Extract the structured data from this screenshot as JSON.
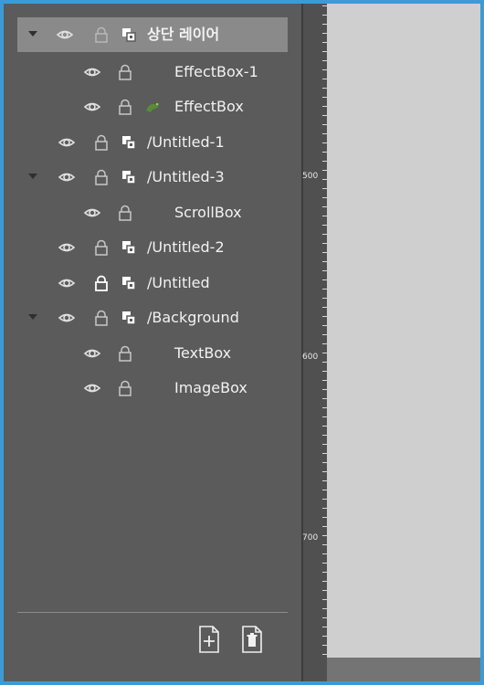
{
  "layers": [
    {
      "name": "상단 레이어",
      "selected": true,
      "expanded": true,
      "type": "group",
      "icon": "layer-group-icon"
    },
    {
      "name": "EffectBox-1",
      "type": "child",
      "icon": null
    },
    {
      "name": "EffectBox",
      "type": "child",
      "icon": "dragon-icon"
    },
    {
      "name": "/Untitled-1",
      "type": "group",
      "icon": "layer-group-icon"
    },
    {
      "name": "/Untitled-3",
      "expanded": true,
      "type": "group",
      "icon": "layer-group-icon"
    },
    {
      "name": "ScrollBox",
      "type": "child",
      "icon": null
    },
    {
      "name": "/Untitled-2",
      "type": "group",
      "icon": "layer-group-icon"
    },
    {
      "name": "/Untitled",
      "type": "group",
      "icon": "layer-group-icon",
      "locked_emphasis": true
    },
    {
      "name": "/Background",
      "expanded": true,
      "type": "group",
      "icon": "layer-group-icon"
    },
    {
      "name": "TextBox",
      "type": "child",
      "icon": null
    },
    {
      "name": "ImageBox",
      "type": "child",
      "icon": null
    }
  ],
  "toolbar": {
    "add_icon": "add-page-icon",
    "delete_icon": "delete-page-icon"
  },
  "ruler": {
    "labels": [
      "500",
      "600",
      "700"
    ]
  },
  "colors": {
    "frame": "#3a9bd6",
    "panel": "#5b5b5b",
    "selected_row": "#8a8a8a",
    "canvas": "#cfcfcf"
  }
}
